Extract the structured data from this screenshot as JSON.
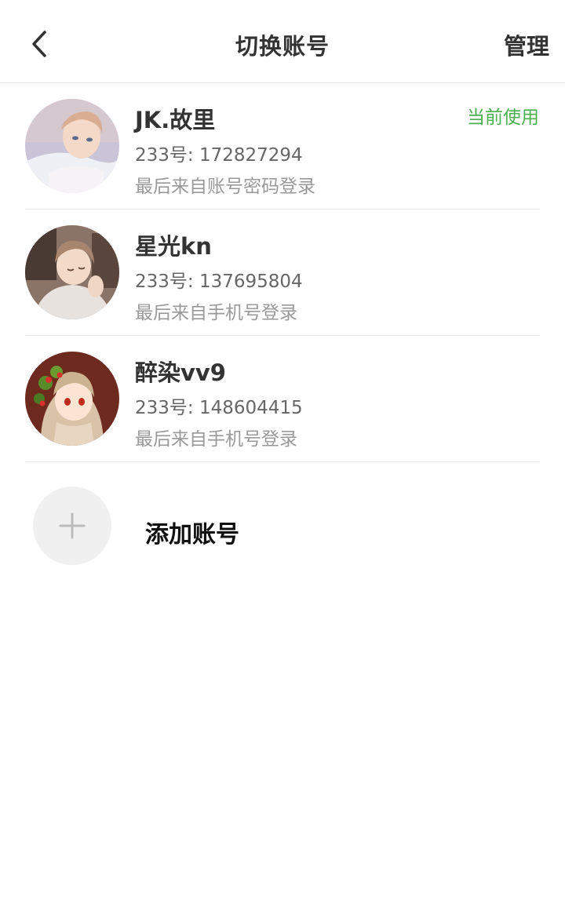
{
  "header": {
    "title": "切换账号",
    "manage_label": "管理",
    "back_icon": "chevron-left-icon"
  },
  "accounts": [
    {
      "nickname": "JK.故里",
      "id_text": "233号: 172827294",
      "login_source": "最后来自账号密码登录",
      "current_label": "当前使用"
    },
    {
      "nickname": "星光kn",
      "id_text": "233号: 137695804",
      "login_source": "最后来自手机号登录"
    },
    {
      "nickname": "醉染vv9",
      "id_text": "233号: 148604415",
      "login_source": "最后来自手机号登录"
    }
  ],
  "add_account": {
    "label": "添加账号",
    "icon": "plus-icon"
  },
  "colors": {
    "accent_green": "#4caf50",
    "divider": "#ebebeb",
    "add_circle_bg": "#f0f0f0"
  }
}
